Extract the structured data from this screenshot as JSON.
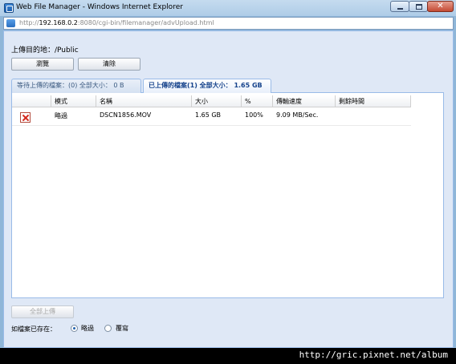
{
  "window": {
    "title": "Web File Manager - Windows Internet Explorer",
    "icon": "ie-page-icon",
    "close_symbol": "✕"
  },
  "address": {
    "url_prefix": "http://",
    "url_host": "192.168.0.2",
    "url_rest": ":8080/cgi-bin/filemanager/advUpload.html"
  },
  "upload": {
    "destination": "上傳目的地：/Public",
    "browse_label": "瀏覽",
    "clear_label": "清除"
  },
  "tabs": [
    {
      "label": "等待上傳的檔案：(0) 全部大小： 0 B",
      "active": false
    },
    {
      "label": "已上傳的檔案(1) 全部大小： 1.65 GB",
      "active": true
    }
  ],
  "grid": {
    "columns": [
      "模式",
      "名稱",
      "大小",
      "%",
      "傳輸速度",
      "剩餘時間"
    ],
    "rows": [
      {
        "mode": "略過",
        "name": "DSCN1856.MOV",
        "size": "1.65 GB",
        "percent": "100%",
        "speed": "9.09 MB/Sec.",
        "remaining": ""
      }
    ]
  },
  "footer": {
    "upload_all_label": "全部上傳",
    "exists_label": "如檔案已存在：",
    "option_skip": "略過",
    "option_overwrite": "覆寫",
    "selected": "skip"
  },
  "watermark": "http://gric.pixnet.net/album",
  "colors": {
    "title_bar": "#aecce7",
    "page_bg": "#dfe8f6",
    "tab_active_text": "#15428b",
    "delete_red": "#d3261a"
  }
}
